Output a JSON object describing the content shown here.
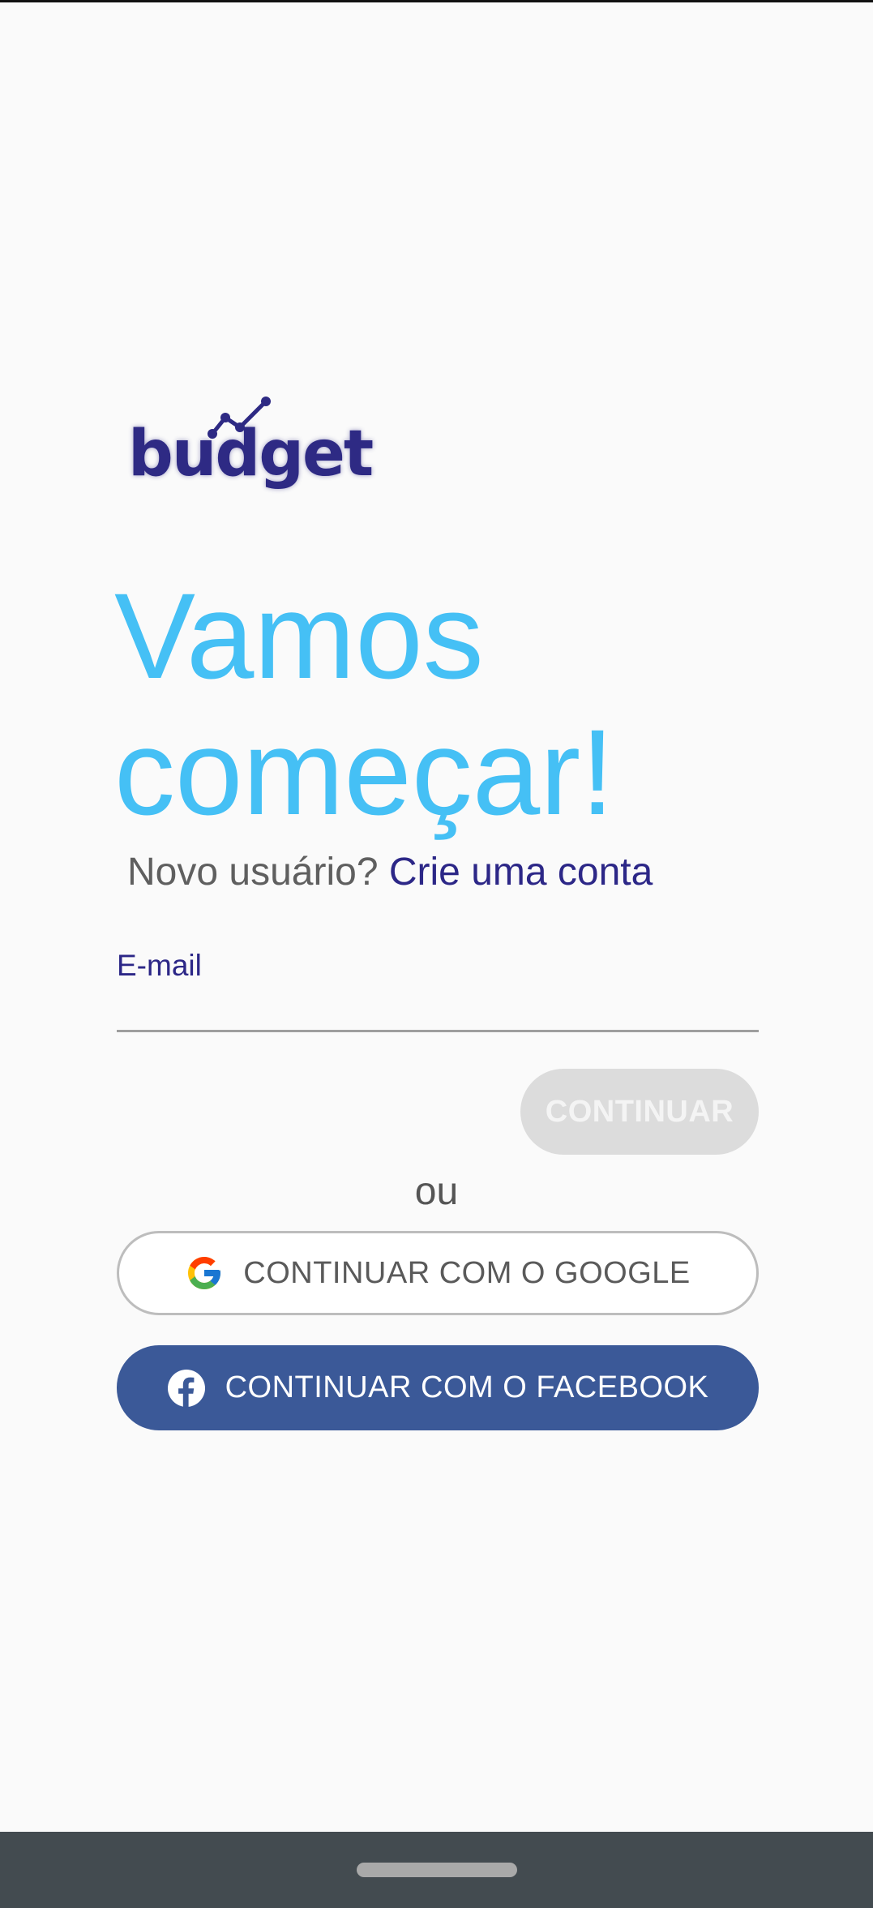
{
  "app": {
    "logo_text": "budget"
  },
  "headline": {
    "line1": "Vamos",
    "line2": "começar!"
  },
  "signup": {
    "prompt": "Novo usuário?",
    "link": "Crie uma conta"
  },
  "email": {
    "label": "E-mail",
    "value": ""
  },
  "buttons": {
    "continue": "CONTINUAR",
    "or": "ou",
    "google": "CONTINUAR COM O GOOGLE",
    "facebook": "CONTINUAR COM O FACEBOOK"
  },
  "colors": {
    "headline": "#45c0f5",
    "brand": "#2c2787",
    "facebook": "#3b5998",
    "disabled_button": "#dcdcdc"
  },
  "icons": {
    "logo_mark": "trend-line-icon",
    "google": "google-icon",
    "facebook": "facebook-icon"
  }
}
